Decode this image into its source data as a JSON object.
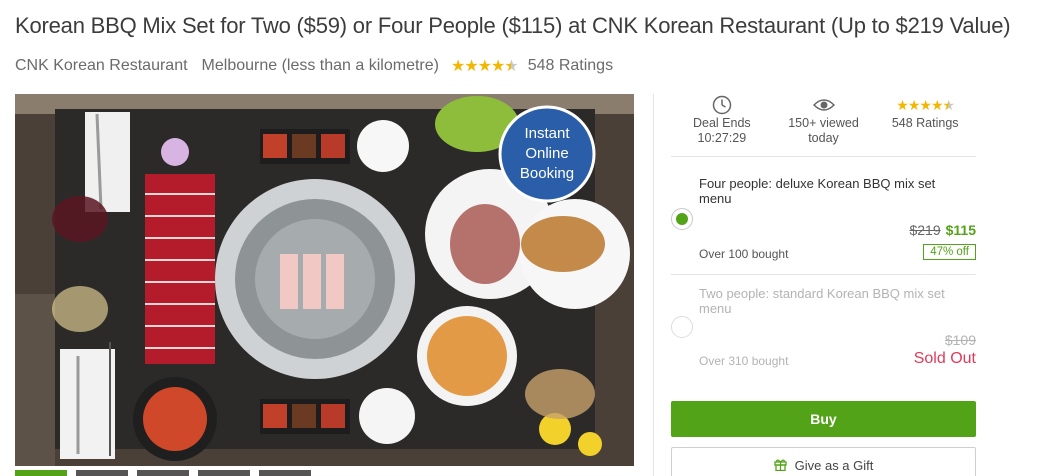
{
  "deal": {
    "title": "Korean BBQ Mix Set for Two ($59) or Four People ($115) at CNK Korean Restaurant (Up to $219 Value)",
    "merchant": "CNK Korean Restaurant",
    "location": "Melbourne (less than a kilometre)",
    "rating": 4.5,
    "ratings_text": "548 Ratings"
  },
  "image": {
    "badge_line1": "Instant",
    "badge_line2": "Online",
    "badge_line3": "Booking",
    "thumbnail_count": 5,
    "active_thumbnail": 1
  },
  "stats": {
    "deal_ends_label": "Deal Ends",
    "deal_ends_time": "10:27:29",
    "viewed_line1": "150+ viewed",
    "viewed_line2": "today",
    "ratings_label": "548 Ratings"
  },
  "options": [
    {
      "name": "Four people: deluxe Korean BBQ mix set menu",
      "original_price": "$219",
      "price": "$115",
      "bought": "Over 100 bought",
      "discount": "47% off",
      "selected": true
    },
    {
      "name": "Two people: standard Korean BBQ mix set menu",
      "original_price": "$109",
      "bought": "Over 310 bought",
      "status": "Sold Out",
      "selected": false
    }
  ],
  "actions": {
    "buy_label": "Buy",
    "gift_label": "Give as a Gift"
  },
  "colors": {
    "accent": "#53a318",
    "star": "#f2b705",
    "sold_out": "#e03b59",
    "badge_blue": "#2a5ea8"
  }
}
